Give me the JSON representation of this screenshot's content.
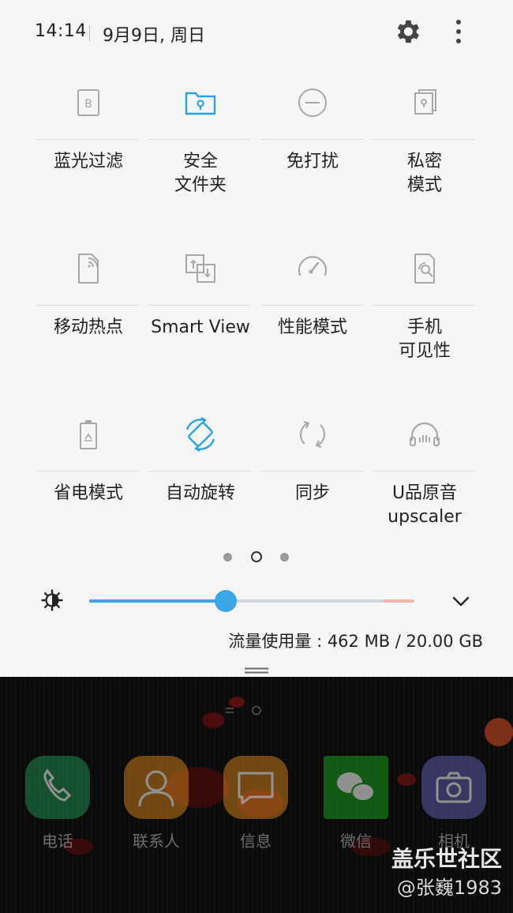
{
  "status_bar": {
    "time": "14:14",
    "date": "9月9日, 周日",
    "settings_icon": "gear-icon",
    "more_icon": "more-vertical-icon"
  },
  "tiles": [
    {
      "label": "蓝光过滤",
      "icon": "blue-light-filter-icon",
      "active": false
    },
    {
      "label": "安全\n文件夹",
      "icon": "secure-folder-icon",
      "active": true
    },
    {
      "label": "免打扰",
      "icon": "do-not-disturb-icon",
      "active": false
    },
    {
      "label": "私密\n模式",
      "icon": "private-mode-icon",
      "active": false
    },
    {
      "label": "移动热点",
      "icon": "mobile-hotspot-icon",
      "active": false
    },
    {
      "label": "Smart View",
      "icon": "smart-view-icon",
      "active": false
    },
    {
      "label": "性能模式",
      "icon": "performance-mode-icon",
      "active": false
    },
    {
      "label": "手机\n可见性",
      "icon": "phone-visibility-icon",
      "active": false
    },
    {
      "label": "省电模式",
      "icon": "power-saving-icon",
      "active": false
    },
    {
      "label": "自动旋转",
      "icon": "auto-rotate-icon",
      "active": true
    },
    {
      "label": "同步",
      "icon": "sync-icon",
      "active": false
    },
    {
      "label": "U品原音\nupscaler",
      "icon": "uhq-upscaler-icon",
      "active": false
    }
  ],
  "pager": {
    "pages": 3,
    "current": 2
  },
  "brightness": {
    "level": 0.42,
    "icon": "brightness-icon"
  },
  "data_usage": "流量使用量 : 462 MB / 20.00 GB",
  "colors": {
    "accent": "#3aa6e4",
    "inactive_icon": "#a8a8a8",
    "text": "#222222",
    "panel_bg": "#f6f6f6"
  },
  "home_apps": [
    {
      "label": "电话",
      "icon": "phone-icon",
      "color": "#1f8a4c"
    },
    {
      "label": "联系人",
      "icon": "contacts-icon",
      "color": "#c87a1a"
    },
    {
      "label": "信息",
      "icon": "messages-icon",
      "color": "#c87a1a"
    },
    {
      "label": "微信",
      "icon": "wechat-icon",
      "color": "#1a9a1a"
    },
    {
      "label": "相机",
      "icon": "camera-icon",
      "color": "#5a5aa8"
    }
  ],
  "watermark": {
    "line1": "盖乐世社区",
    "line2": "@张巍1983"
  }
}
